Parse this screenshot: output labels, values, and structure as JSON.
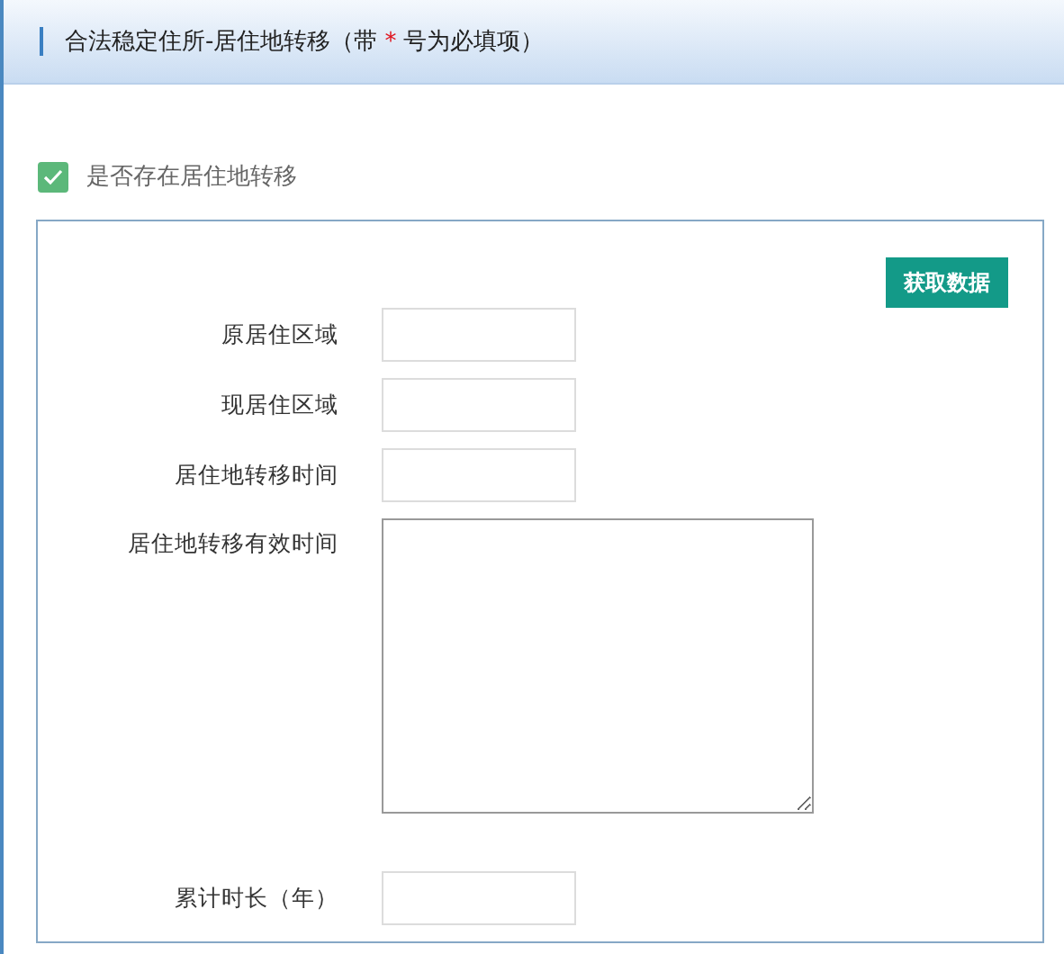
{
  "header": {
    "title_before": "合法稳定住所-居住地转移（带",
    "required_mark": "*",
    "title_after": "号为必填项）"
  },
  "toggle": {
    "label": "是否存在居住地转移",
    "checked": true
  },
  "panel": {
    "button": "获取数据",
    "fields": [
      {
        "label": "原居住区域",
        "kind": "input"
      },
      {
        "label": "现居住区域",
        "kind": "input"
      },
      {
        "label": "居住地转移时间",
        "kind": "input"
      },
      {
        "label": "居住地转移有效时间",
        "kind": "textarea"
      },
      {
        "label": "累计时长（年）",
        "kind": "input"
      }
    ]
  }
}
